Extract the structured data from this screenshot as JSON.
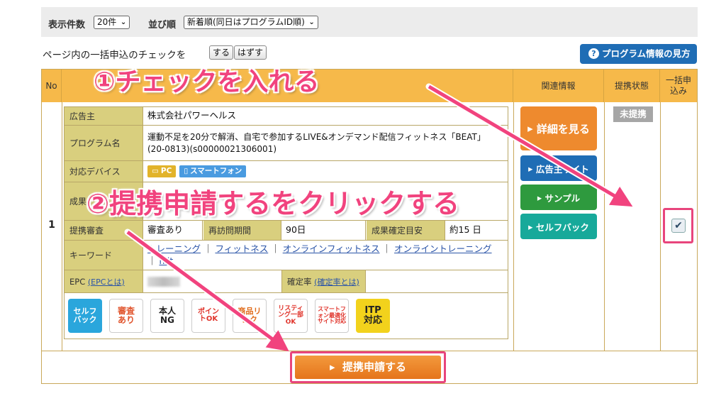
{
  "filter": {
    "count_label": "表示件数",
    "count_value": "20件",
    "sort_label": "並び順",
    "sort_value": "新着順(同日はプログラムID順)"
  },
  "bulk": {
    "text": "ページ内の一括申込のチェックを",
    "on_button": "する",
    "off_button": "はずす"
  },
  "info_button": "プログラム情報の見方",
  "table": {
    "headers": {
      "no": "No",
      "related": "関連情報",
      "status": "提携状態",
      "bulk": "一括申込み"
    },
    "row_no": "1",
    "details": {
      "advertiser_label": "広告主",
      "advertiser": "株式会社パワーヘルス",
      "program_label": "プログラム名",
      "program": "運動不足を20分で解消、自宅で参加するLIVE&オンデマンド配信フィットネス「BEAT」(20-0813)(s00000021306001)",
      "device_label": "対応デバイス",
      "device_pc": "PC",
      "device_sp": "スマートフォン",
      "result_label": "成果",
      "review_label": "提携審査",
      "review": "審査あり",
      "revisit_label": "再訪問期間",
      "revisit": "90日",
      "confirm_label": "成果確定目安",
      "confirm": "約15 日",
      "keyword_label": "キーワード",
      "keywords": [
        "トレーニング",
        "フィットネス",
        "オンラインフィットネス",
        "オンライントレーニング",
        "hiit"
      ],
      "epc_label": "EPC",
      "epc_link": "(EPCとは)",
      "rate_label": "確定率",
      "rate_link": "(確定率とは)"
    },
    "features": [
      "セルフバック",
      "審査あり",
      "本人NG",
      "ポイントOK",
      "商品リンク",
      "リスティング一部OK",
      "スマートフォン最適化サイト対応",
      "ITP対応"
    ],
    "side_buttons": [
      "詳細を見る",
      "広告主サイト",
      "サンプル",
      "セルフバック"
    ],
    "status": "未提携",
    "checked": true
  },
  "apply_button": "提携申請する",
  "annotations": {
    "step1": "①チェックを入れる",
    "step2": "②提携申請するをクリックする"
  },
  "colors": {
    "header": "#f6b94a",
    "accent": "#e8457c",
    "orange_button": "#ee8a2e",
    "teal_button": "#17a99a",
    "blue_button": "#1f6db5"
  }
}
